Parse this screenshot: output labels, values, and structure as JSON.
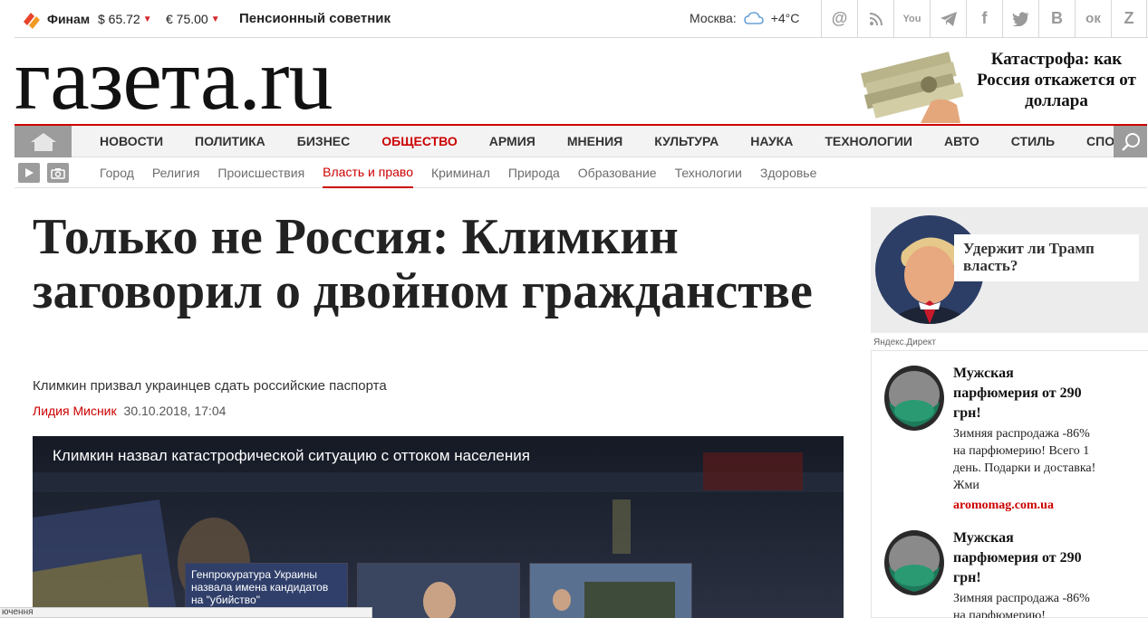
{
  "topbar": {
    "finam_label": "Финам",
    "usd_rate": "$ 65.72",
    "eur_rate": "€ 75.00",
    "pension_link": "Пенсионный советник",
    "city_label": "Москва:",
    "temperature": "+4°C",
    "social": [
      {
        "name": "email",
        "glyph": "@"
      },
      {
        "name": "rss",
        "glyph": "◔"
      },
      {
        "name": "youtube",
        "glyph": "You"
      },
      {
        "name": "telegram",
        "glyph": "➤"
      },
      {
        "name": "facebook",
        "glyph": "f"
      },
      {
        "name": "twitter",
        "glyph": "t"
      },
      {
        "name": "vk",
        "glyph": "B"
      },
      {
        "name": "odnoklassniki",
        "glyph": "ок"
      },
      {
        "name": "zen",
        "glyph": "Z"
      }
    ]
  },
  "logo": {
    "text": "газета.ru"
  },
  "promo": {
    "text": "Катастрофа: как Россия откажется от доллара"
  },
  "nav": {
    "items": [
      {
        "label": "Новости"
      },
      {
        "label": "Политика"
      },
      {
        "label": "Бизнес"
      },
      {
        "label": "Общество"
      },
      {
        "label": "Армия"
      },
      {
        "label": "Мнения"
      },
      {
        "label": "Культура"
      },
      {
        "label": "Наука"
      },
      {
        "label": "Технологии"
      },
      {
        "label": "Авто"
      },
      {
        "label": "Стиль"
      },
      {
        "label": "Спорт"
      }
    ],
    "active_index": 3
  },
  "subnav": {
    "items": [
      {
        "label": "Город"
      },
      {
        "label": "Религия"
      },
      {
        "label": "Происшествия"
      },
      {
        "label": "Власть и право"
      },
      {
        "label": "Криминал"
      },
      {
        "label": "Природа"
      },
      {
        "label": "Образование"
      },
      {
        "label": "Технологии"
      },
      {
        "label": "Здоровье"
      }
    ],
    "active_index": 3
  },
  "article": {
    "headline": "Только не Россия: Климкин заговорил о двойном гражданстве",
    "lead": "Климкин призвал украинцев сдать российские паспорта",
    "author": "Лидия Мисник",
    "date": "30.10.2018, 17:04"
  },
  "video": {
    "title": "Климкин назвал катастрофической ситуацию с оттоком населения",
    "thumbs": [
      {
        "caption": "Генпрокуратура Украины назвала имена кандидатов на \"убийство\""
      },
      {
        "caption": ""
      },
      {
        "caption": ""
      }
    ]
  },
  "statusbar": {
    "text": "ючення"
  },
  "sidebar": {
    "teaser_title": "Удержит ли Трамп власть?",
    "ad_source": "Яндекс.Директ",
    "ads": [
      {
        "title": "Мужская парфюмерия от 290 грн!",
        "text": "Зимняя распродажа -86% на парфюмерию! Всего 1 день. Подарки и доставка! Жми",
        "link": "aromomag.com.ua"
      },
      {
        "title": "Мужская парфюмерия от 290 грн!",
        "text": "Зимняя распродажа -86% на парфюмерию!",
        "link": ""
      }
    ]
  },
  "colors": {
    "accent": "#cc0000",
    "nav_bg": "#f3f3f3",
    "icon_bg": "#9c9c9c"
  }
}
